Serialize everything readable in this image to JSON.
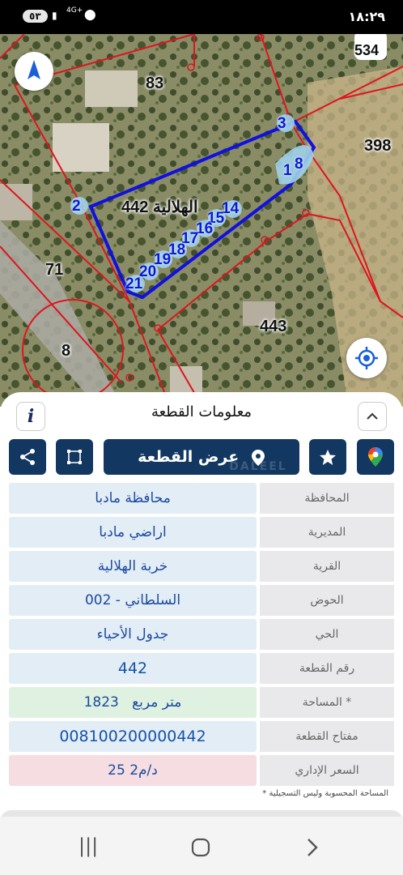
{
  "status_bar": {
    "time": "١٨:٢٩",
    "notification_badge": "٥٣",
    "network": "4G+",
    "icons": [
      "signal-icon",
      "location-icon"
    ]
  },
  "map": {
    "parcel_labels": [
      "83",
      "398",
      "71",
      "443",
      "8",
      "534"
    ],
    "selected_parcel_label": "الهلالية 442",
    "vertex_numbers": [
      "3",
      "1",
      "8",
      "2",
      "14",
      "15",
      "16",
      "17",
      "18",
      "19",
      "20",
      "21"
    ],
    "colors": {
      "boundary": "#e0141e",
      "selected_outline": "#1010e0",
      "vertex_text": "#0a1ad0"
    }
  },
  "panel": {
    "title": "معلومات القطعة",
    "show_plot_label": "عرض القطعة",
    "watermark": "DALEEL AQAR",
    "rows": [
      {
        "label": "المحافظة",
        "value": "محافظة مادبا"
      },
      {
        "label": "المديرية",
        "value": "اراضي مادبا"
      },
      {
        "label": "القرية",
        "value": "خربة الهلالية"
      },
      {
        "label": "الحوض",
        "value": "السلطاني - 002"
      },
      {
        "label": "الحي",
        "value": "جدول الأحياء"
      },
      {
        "label": "رقم القطعة",
        "value": "442"
      },
      {
        "label": "المساحة *",
        "value_number": "1823",
        "value_unit": "متر مربع"
      },
      {
        "label": "مفتاح القطعة",
        "value": "008100200000442"
      },
      {
        "label": "السعر الإداري",
        "value": "25 د/م2"
      }
    ],
    "footnote": "* المساحة المحسوبة وليس التسجيلية",
    "colors": {
      "toolbar_bg": "#123761",
      "value_text": "#1b4aa0"
    }
  },
  "navbar": {
    "icons": [
      "recent-apps-icon",
      "home-icon",
      "back-icon"
    ]
  }
}
